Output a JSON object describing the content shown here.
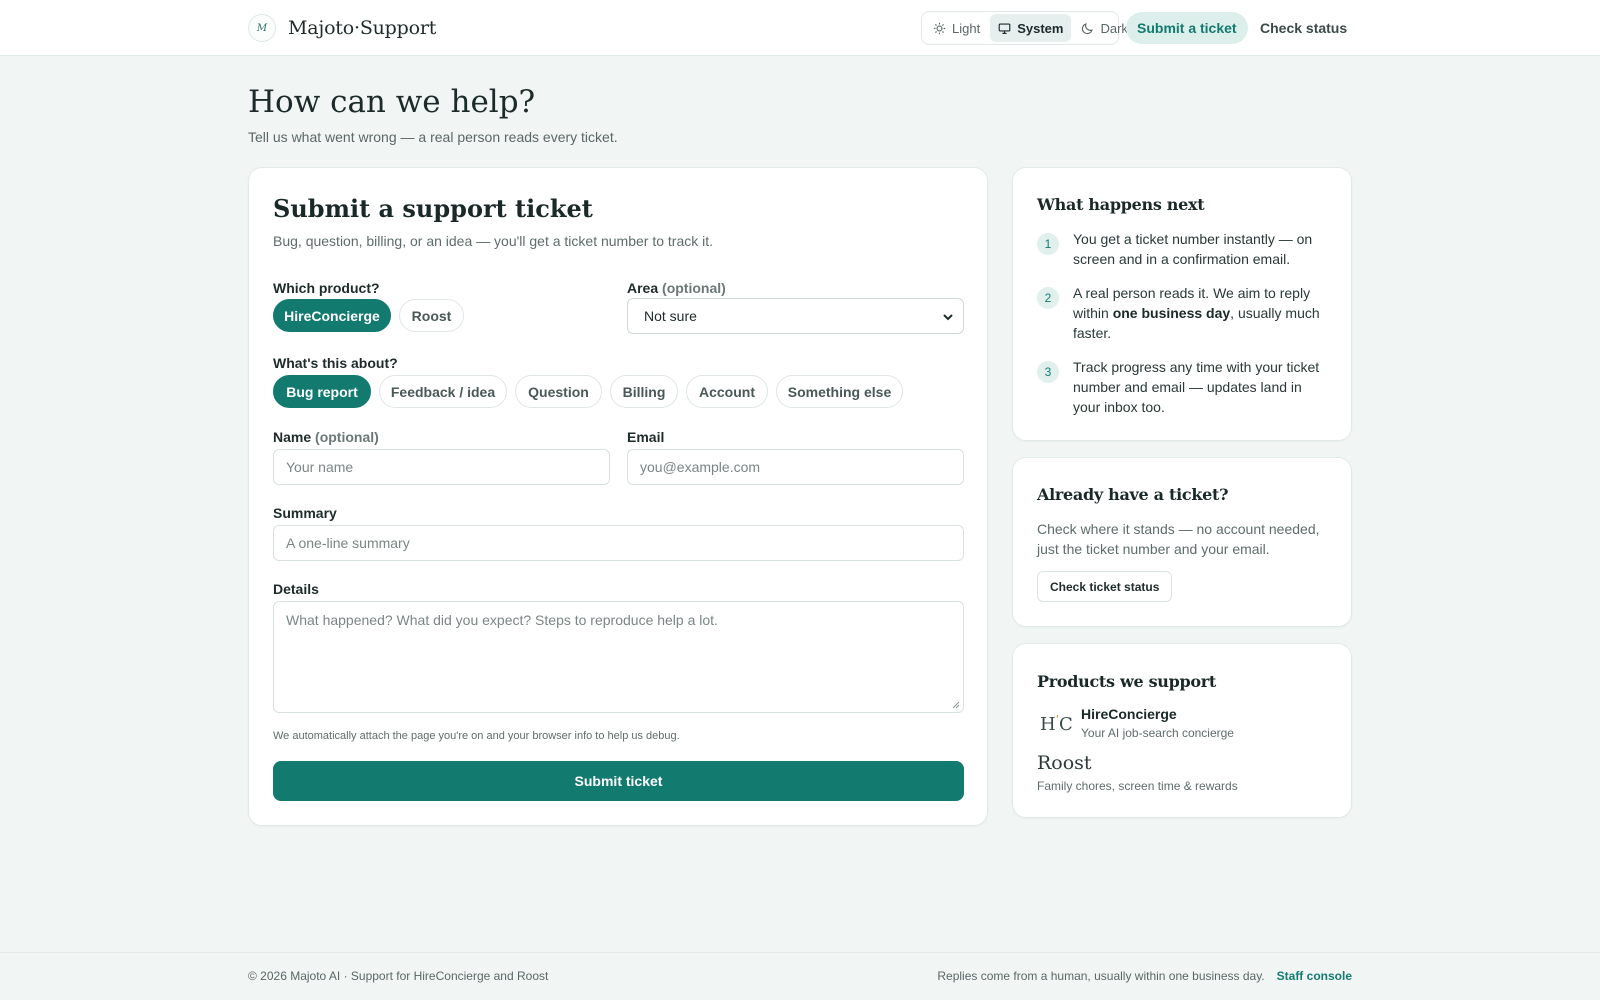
{
  "header": {
    "brand": "Majoto·Support",
    "logo_letter": "M",
    "theme": [
      {
        "label": "Light",
        "icon": "sun-icon",
        "active": false
      },
      {
        "label": "System",
        "icon": "monitor-icon",
        "active": true
      },
      {
        "label": "Dark",
        "icon": "moon-icon",
        "active": false
      }
    ],
    "submit_label": "Submit a ticket",
    "status_label": "Check status"
  },
  "hero": {
    "title": "How can we help?",
    "subtitle": "Tell us what went wrong — a real person reads every ticket."
  },
  "form": {
    "title": "Submit a support ticket",
    "subtitle": "Bug, question, billing, or an idea — you'll get a ticket number to track it.",
    "product_label": "Which product?",
    "products": [
      "HireConcierge",
      "Roost"
    ],
    "selected_product": "HireConcierge",
    "area_label": "Area",
    "area_optional": "(optional)",
    "area_value": "Not sure",
    "about_label": "What's this about?",
    "categories": [
      "Bug report",
      "Feedback / idea",
      "Question",
      "Billing",
      "Account",
      "Something else"
    ],
    "selected_category": "Bug report",
    "name_label": "Name",
    "name_optional": "(optional)",
    "name_placeholder": "Your name",
    "email_label": "Email",
    "email_placeholder": "you@example.com",
    "summary_label": "Summary",
    "summary_placeholder": "A one-line summary",
    "details_label": "Details",
    "details_placeholder": "What happened? What did you expect? Steps to reproduce help a lot.",
    "hint": "We automatically attach the page you're on and your browser info to help us debug.",
    "submit_label": "Submit ticket"
  },
  "next": {
    "title": "What happens next",
    "steps": [
      {
        "num": "1",
        "text_before": "You get a ticket number instantly — on screen and in a confirmation email.",
        "bold": "",
        "text_after": ""
      },
      {
        "num": "2",
        "text_before": "A real person reads it. We aim to reply within ",
        "bold": "one business day",
        "text_after": ", usually much faster."
      },
      {
        "num": "3",
        "text_before": "Track progress any time with your ticket number and email — updates land in your inbox too.",
        "bold": "",
        "text_after": ""
      }
    ]
  },
  "existing": {
    "title": "Already have a ticket?",
    "body": "Check where it stands — no account needed, just the ticket number and your email.",
    "button": "Check ticket status"
  },
  "products_card": {
    "title": "Products we support",
    "items": [
      {
        "logo": "HC",
        "name": "HireConcierge",
        "desc": "Your AI job-search concierge"
      },
      {
        "logo": "Roost",
        "name": "Roost",
        "desc": "Family chores, screen time & rewards"
      }
    ]
  },
  "footer": {
    "left": "© 2026 Majoto AI · Support for HireConcierge and Roost",
    "right": "Replies come from a human, usually within one business day.",
    "link": "Staff console"
  },
  "colors": {
    "accent": "#137a70",
    "accent_soft": "#dcefeb",
    "background": "#f1f6f5"
  }
}
